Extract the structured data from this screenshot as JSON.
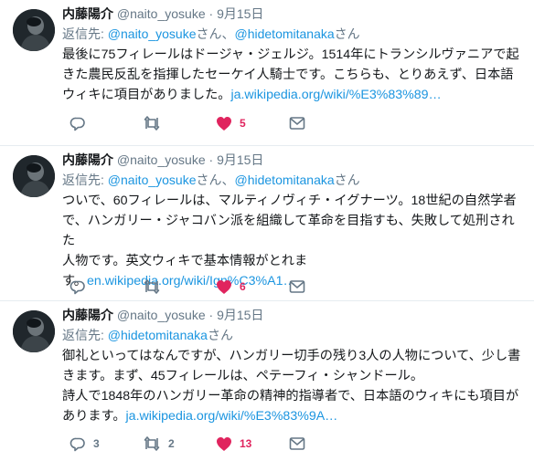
{
  "tweets": [
    {
      "author_name": "内藤陽介",
      "handle": "@naito_yosuke",
      "separator": "·",
      "date": "9月15日",
      "reply_label": "返信先:",
      "reply_mentions": [
        {
          "handle": "@naito_yosuke",
          "suffix": "さん、"
        },
        {
          "handle": "@hidetomitanaka",
          "suffix": "さん"
        }
      ],
      "text_lines": [
        "最後に75フィレールはドージャ・ジェルジ。1514年にトランシルヴァニアで起",
        "きた農民反乱を指揮したセーケイ人騎士です。こちらも、とりあえず、日本語",
        "ウィキに項目がありました。"
      ],
      "link": "ja.wikipedia.org/wiki/%E3%83%89…",
      "reply_count": "",
      "retweet_count": "",
      "like_count": "5",
      "liked": true
    },
    {
      "author_name": "内藤陽介",
      "handle": "@naito_yosuke",
      "separator": "·",
      "date": "9月15日",
      "reply_label": "返信先:",
      "reply_mentions": [
        {
          "handle": "@naito_yosuke",
          "suffix": "さん、"
        },
        {
          "handle": "@hidetomitanaka",
          "suffix": "さん"
        }
      ],
      "text_lines": [
        "ついで、60フィレールは、マルティノヴィチ・イグナーツ。18世紀の自然学者",
        "で、ハンガリー・ジャコバン派を組織して革命を目指すも、失敗して処刑された",
        "人物です。英文ウィキで基本情報がとれま",
        "す。"
      ],
      "link": "en.wikipedia.org/wiki/Ign%C3%A1…",
      "reply_count": "",
      "retweet_count": "",
      "like_count": "6",
      "liked": true
    },
    {
      "author_name": "内藤陽介",
      "handle": "@naito_yosuke",
      "separator": "·",
      "date": "9月15日",
      "reply_label": "返信先:",
      "reply_mentions": [
        {
          "handle": "@hidetomitanaka",
          "suffix": "さん"
        }
      ],
      "text_lines": [
        "御礼といってはなんですが、ハンガリー切手の残り3人の人物について、少し書",
        "きます。まず、45フィレールは、ペテーフィ・シャンドール。",
        "詩人で1848年のハンガリー革命の精神的指導者で、日本語のウィキにも項目が",
        "あります。"
      ],
      "link": "ja.wikipedia.org/wiki/%E3%83%9A…",
      "reply_count": "3",
      "retweet_count": "2",
      "like_count": "13",
      "liked": true
    }
  ],
  "icons": {
    "reply": "reply-icon",
    "retweet": "retweet-icon",
    "like": "heart-icon",
    "dm": "envelope-icon"
  },
  "colors": {
    "link": "#1b95e0",
    "like": "#e0245e",
    "muted": "#657786",
    "text": "#14171a",
    "divider": "#e6ecf0"
  }
}
